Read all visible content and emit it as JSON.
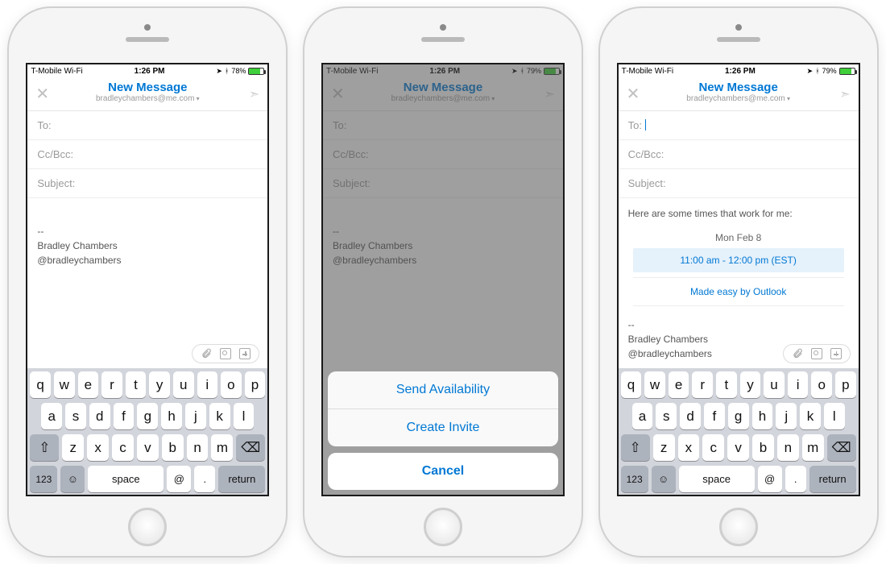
{
  "status": {
    "carrier": "T-Mobile Wi-Fi",
    "wifi_icon": "wifi-icon",
    "time": "1:26 PM",
    "battery_pct_a": "78%",
    "battery_pct_b": "79%"
  },
  "navbar": {
    "title": "New Message",
    "from_email": "bradleychambers@me.com"
  },
  "fields": {
    "to_label": "To:",
    "cc_label": "Cc/Bcc:",
    "subject_label": "Subject:"
  },
  "signature": {
    "dashes": "--",
    "name": "Bradley Chambers",
    "handle": "@bradleychambers"
  },
  "actionsheet": {
    "send_availability": "Send Availability",
    "create_invite": "Create Invite",
    "cancel": "Cancel"
  },
  "availability": {
    "intro": "Here are some times that work for me:",
    "date": "Mon Feb 8",
    "slot": "11:00 am - 12:00 pm (EST)",
    "footer": "Made easy by Outlook"
  },
  "keyboard": {
    "row1": [
      "q",
      "w",
      "e",
      "r",
      "t",
      "y",
      "u",
      "i",
      "o",
      "p"
    ],
    "row2": [
      "a",
      "s",
      "d",
      "f",
      "g",
      "h",
      "j",
      "k",
      "l"
    ],
    "row3": [
      "z",
      "x",
      "c",
      "v",
      "b",
      "n",
      "m"
    ],
    "num": "123",
    "space": "space",
    "at": "@",
    "dot": ".",
    "ret": "return"
  }
}
